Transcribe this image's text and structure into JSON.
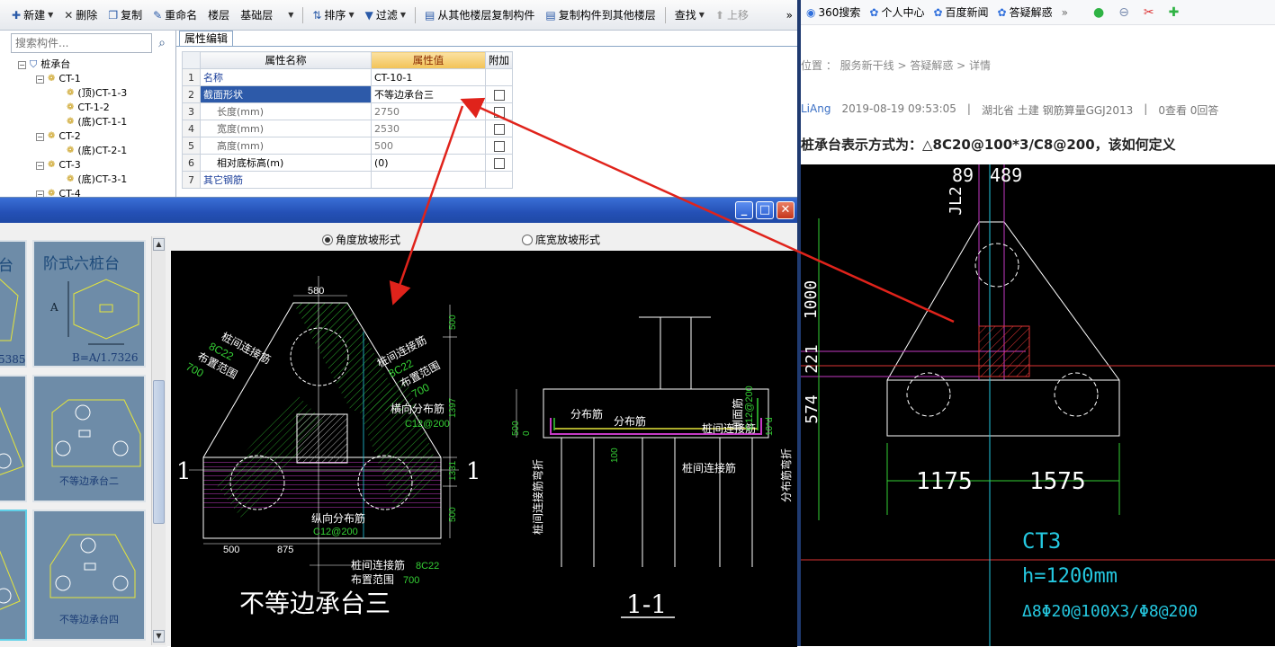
{
  "toolbar": {
    "new": "新建",
    "delete": "删除",
    "copy": "复制",
    "rename": "重命名",
    "floor": "楼层",
    "floor_value": "基础层",
    "sort": "排序",
    "filter": "过滤",
    "copy_from": "从其他楼层复制构件",
    "copy_to": "复制构件到其他楼层",
    "find": "查找",
    "move_up": "上移",
    "more": "»"
  },
  "tree": {
    "search_placeholder": "搜索构件...",
    "items": [
      {
        "label": "桩承台"
      },
      {
        "label": "CT-1"
      },
      {
        "label": "(顶)CT-1-3"
      },
      {
        "label": "CT-1-2"
      },
      {
        "label": "(底)CT-1-1"
      },
      {
        "label": "CT-2"
      },
      {
        "label": "(底)CT-2-1"
      },
      {
        "label": "CT-3"
      },
      {
        "label": "(底)CT-3-1"
      },
      {
        "label": "CT-4"
      }
    ]
  },
  "props": {
    "tab": "属性编辑",
    "headers": [
      "属性名称",
      "属性值",
      "附加"
    ],
    "rows": [
      {
        "idx": "1",
        "name": "名称",
        "value": ""
      },
      {
        "idx": "2",
        "name": "截面形状",
        "value": "不等边承台三"
      },
      {
        "idx": "3",
        "name": "长度(mm)",
        "value": "2750"
      },
      {
        "idx": "4",
        "name": "宽度(mm)",
        "value": "2530"
      },
      {
        "idx": "5",
        "name": "高度(mm)",
        "value": "500"
      },
      {
        "idx": "6",
        "name": "相对底标高(m)",
        "value": "(0)"
      },
      {
        "idx": "7",
        "name": "其它钢筋",
        "value": ""
      }
    ],
    "name_value": "CT-10-1"
  },
  "dialog": {
    "radio1": "角度放坡形式",
    "radio2": "底宽放坡形式",
    "thumbs": {
      "t1_title": "台",
      "t2_title": "阶式六桩台",
      "t2_a": "A",
      "t2_formula": "B=A/1.7326",
      "t1_num": "5385",
      "t4_label": "不等边承台二",
      "t6_label": "不等边承台四"
    }
  },
  "cad_main": {
    "title": "不等边承台三",
    "section_title": "1-1",
    "sec_mark": "1",
    "dims": {
      "d580": "580",
      "d500a": "500",
      "d1397": "1397",
      "d1331": "1331",
      "d500b": "500",
      "d500c": "500",
      "d875": "875",
      "d100": "100",
      "d500s": "500",
      "d0": "0",
      "d10d": "10*d"
    },
    "labels": {
      "l1": "桩间连接筋",
      "l1b": "8C22",
      "l1c": "布置范围",
      "l1d": "700",
      "l2": "桩间连接筋",
      "l2b": "8C22",
      "l2c": "布置范围",
      "l2d": "700",
      "l3": "横向分布筋",
      "l3b": "C12@200",
      "l4": "纵向分布筋",
      "l4b": "C12@200",
      "l5": "桩间连接筋",
      "l5b": "8C22",
      "l5c": "布置范围",
      "l5d": "700",
      "s1": "分布筋",
      "s2": "分布筋",
      "s3": "桩间连接筋",
      "s4": "桩间连接筋",
      "s5": "桩间连接筋弯折",
      "s6": "侧面筋",
      "s7": "C12@200",
      "s8": "分布筋弯折"
    }
  },
  "browser": {
    "bookmarks": [
      "360搜索",
      "个人中心",
      "百度新闻",
      "答疑解惑"
    ],
    "more": "»",
    "crumb": "位置 ： 服务新干线 > 答疑解惑 > 详情",
    "user": "LiAng",
    "date": "2019-08-19 09:53:05",
    "region": "湖北省  土建  钢筋算量GGJ2013",
    "views": "0查看  0回答",
    "question": "桩承台表示方式为：△8C20@100*3/C8@200，该如何定义"
  },
  "cad_right": {
    "top1": "89",
    "top2": "489",
    "jl": "JL2",
    "left_dims": [
      "1000",
      "221",
      "574"
    ],
    "dim1": "1175",
    "dim2": "1575",
    "name": "CT3",
    "height": "h=1200mm",
    "rebar": "Δ8Φ20@100X3/Φ8@200"
  }
}
